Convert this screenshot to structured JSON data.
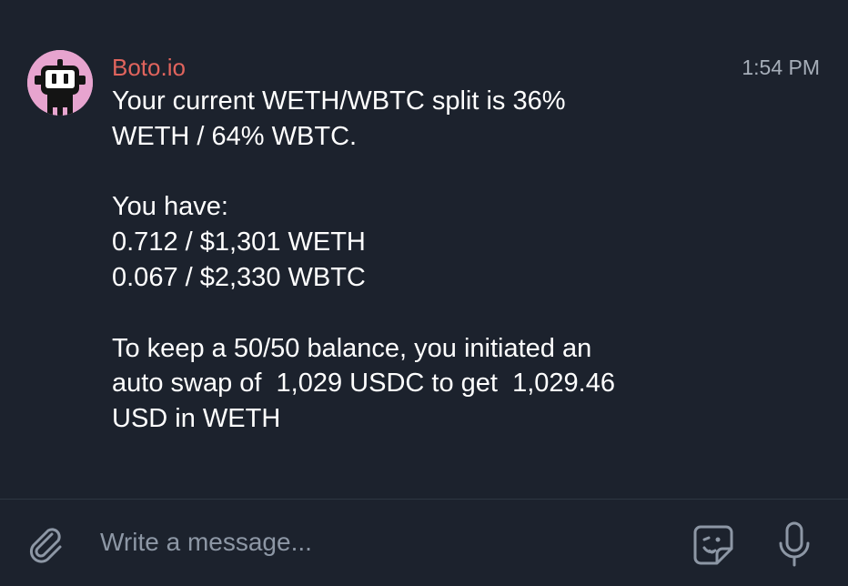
{
  "message": {
    "sender": "Boto.io",
    "time": "1:54 PM",
    "avatar_icon": "robot-icon",
    "lines": [
      "Your current WETH/WBTC split is 36%",
      "WETH / 64% WBTC.",
      "",
      "You have:",
      "0.712 / $1,301 WETH",
      "0.067 / $2,330 WBTC",
      "",
      "To keep a 50/50 balance, you initiated an",
      "auto swap of  1,029 USDC to get  1,029.46",
      "USD in WETH"
    ]
  },
  "composer": {
    "placeholder": "Write a message...",
    "attach_icon": "paperclip-icon",
    "sticker_icon": "sticker-icon",
    "mic_icon": "microphone-icon"
  },
  "colors": {
    "background": "#1c222d",
    "sender_name": "#e0645d",
    "timestamp": "#a6aeb9",
    "icons": "#8d97a5",
    "avatar_bg": "#e7a4cf"
  }
}
